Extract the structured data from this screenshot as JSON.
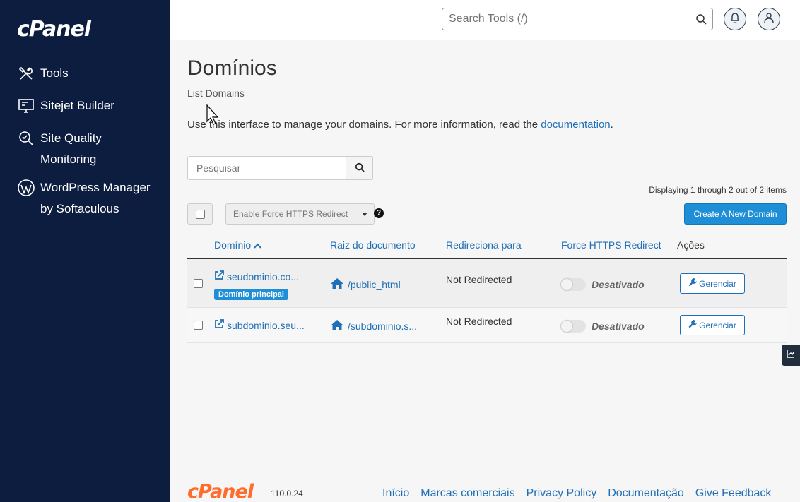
{
  "brand": {
    "logo_text": "cPanel"
  },
  "sidebar": {
    "items": [
      {
        "label": "Tools",
        "icon": "tools-icon"
      },
      {
        "label": "Sitejet Builder",
        "icon": "monitor-icon"
      },
      {
        "label": "Site Quality Monitoring",
        "icon": "magnifier-check-icon"
      },
      {
        "label": "WordPress Manager by Softaculous",
        "icon": "wordpress-icon"
      }
    ]
  },
  "topbar": {
    "search_placeholder": "Search Tools (/)"
  },
  "page": {
    "title": "Domínios",
    "subtitle": "List Domains",
    "intro_text": "Use this interface to manage your domains. For more information, read the ",
    "intro_link": "documentation",
    "intro_end": "."
  },
  "filter": {
    "placeholder": "Pesquisar"
  },
  "displaying_text": "Displaying 1 through 2 out of 2 items",
  "bulk_action_label": "Enable Force HTTPS Redirect",
  "help_glyph": "?",
  "create_button_label": "Create A New Domain",
  "table": {
    "headers": {
      "domain": "Domínio",
      "docroot": "Raiz do documento",
      "redirect": "Redireciona para",
      "https": "Force HTTPS Redirect",
      "actions": "Ações"
    },
    "rows": [
      {
        "domain": "seudominio.co...",
        "badge": "Domínio principal",
        "docroot": "/public_html",
        "redirect": "Not Redirected",
        "https_state": "Desativado",
        "manage": "Gerenciar"
      },
      {
        "domain": "subdominio.seu...",
        "docroot": "/subdominio.s...",
        "redirect": "Not Redirected",
        "https_state": "Desativado",
        "manage": "Gerenciar"
      }
    ]
  },
  "footer": {
    "logo_text": "cPanel",
    "version": "110.0.24",
    "links": [
      "Início",
      "Marcas comerciais",
      "Privacy Policy",
      "Documentação",
      "Give Feedback"
    ]
  },
  "colors": {
    "sidebar_bg": "#0d1d3f",
    "accent_blue": "#1e8fd6",
    "link_blue": "#1f6fb6",
    "brand_orange": "#ff6c2c"
  }
}
